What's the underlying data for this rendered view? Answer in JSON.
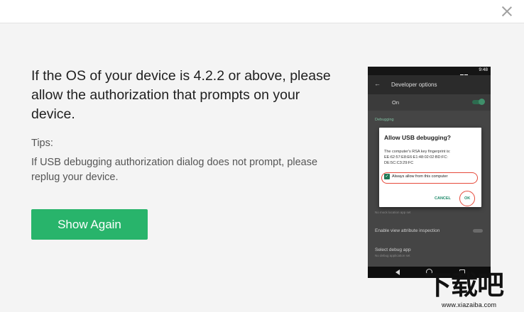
{
  "window": {
    "close_icon": "close-icon"
  },
  "main": {
    "heading": "If the OS of your device is 4.2.2 or above, please allow the authorization that prompts on your device.",
    "tips_title": "Tips:",
    "tips_text": "If USB debugging authorization dialog does not prompt, please replug your device.",
    "show_again_label": "Show Again",
    "accent_color": "#28b46b"
  },
  "phone": {
    "status_time": "9:48",
    "appbar_title": "Developer options",
    "on_label": "On",
    "section_label": "Debugging",
    "row_view_attr": "Enable view attribute inspection",
    "row_mock_sub": "No mock location app set",
    "row_debug_app": "Select debug app",
    "row_debug_app_sub": "No debug application set",
    "dialog": {
      "title": "Allow USB debugging?",
      "body": "The computer's RSA key fingerprint is: EE:62:57:E8:E6:E1:48:02:02:BD:FC: DE:5C:C3:29:FC",
      "checkbox_label": "Always allow from this computer",
      "cancel_label": "CANCEL",
      "ok_label": "OK"
    }
  },
  "watermark": {
    "main": "下载吧",
    "sub": "www.xiazaiba.com"
  }
}
